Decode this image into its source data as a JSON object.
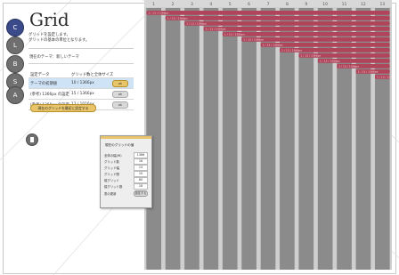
{
  "app": {
    "title": "Grid"
  },
  "sidebar": {
    "items": [
      {
        "label": "C",
        "active": true
      },
      {
        "label": "L",
        "active": false
      },
      {
        "label": "B",
        "active": false
      },
      {
        "label": "S",
        "active": false
      },
      {
        "label": "A",
        "active": false
      }
    ]
  },
  "intro": {
    "line1": "グリッドを設定します。",
    "line2": "グリッドの基本の単位となります。"
  },
  "theme": {
    "label": "現在のテーマ：新しいテーマ"
  },
  "table": {
    "headers": [
      "設定データ",
      "グリッド数と全体サイズ"
    ],
    "rows": [
      {
        "name": "テーマの初期値",
        "value": "10 / 1366px",
        "action": "ok",
        "selected": true
      },
      {
        "name": "(参考) 1366px の設定",
        "value": "15 / 1366px",
        "action": "ok",
        "selected": false
      },
      {
        "name": "(参考) 1366px の設定",
        "value": "12 / 1016px",
        "action": "ok",
        "selected": false
      }
    ]
  },
  "apply_button": "現在のグリッドを最初に設定する",
  "dialog": {
    "title": "現在のグリッドの値",
    "rows": [
      {
        "label": "全体の幅(W)",
        "value": "1366"
      },
      {
        "label": "グリッド数",
        "value": "16"
      },
      {
        "label": "グリッド幅",
        "value": "13"
      },
      {
        "label": "グリッド間",
        "value": "10"
      },
      {
        "label": "縦グリッド",
        "value": "60"
      },
      {
        "label": "縦グリッド数",
        "value": "18"
      }
    ],
    "action_label": "表の更新",
    "action_button": "設定する"
  },
  "grid": {
    "column_numbers": [
      "1",
      "2",
      "3",
      "4",
      "5",
      "6",
      "7",
      "8",
      "9",
      "10",
      "11",
      "12",
      "13"
    ],
    "bar_label": "1 / 13 / 1366px",
    "colors": {
      "column": "#8b8b8b",
      "gutter": "#cfcfcf",
      "bar": "#b0445a",
      "header": "#d8d8d8"
    }
  }
}
